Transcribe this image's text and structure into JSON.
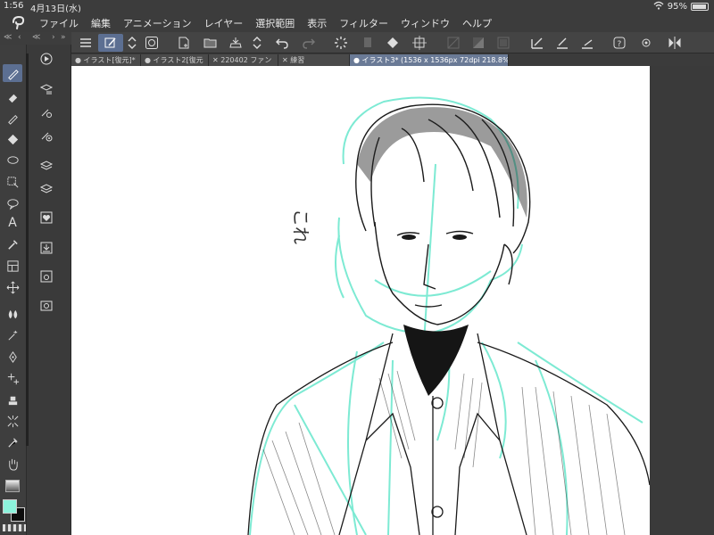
{
  "status": {
    "time": "1:56",
    "date": "4月13日(水)",
    "battery": "95%"
  },
  "menu": [
    "ファイル",
    "編集",
    "アニメーション",
    "レイヤー",
    "選択範囲",
    "表示",
    "フィルター",
    "ウィンドウ",
    "ヘルプ"
  ],
  "tabs": [
    "イラスト[復元]*",
    "イラスト2[復元",
    "220402 ファン",
    "練習",
    "イラスト3* (1536 x 1536px 72dpi 218.8%)"
  ],
  "colors": {
    "main": "#8cf3dc",
    "sub": "#0d0d0d",
    "accent": "#5c6f92"
  },
  "sketch_text": "これ"
}
